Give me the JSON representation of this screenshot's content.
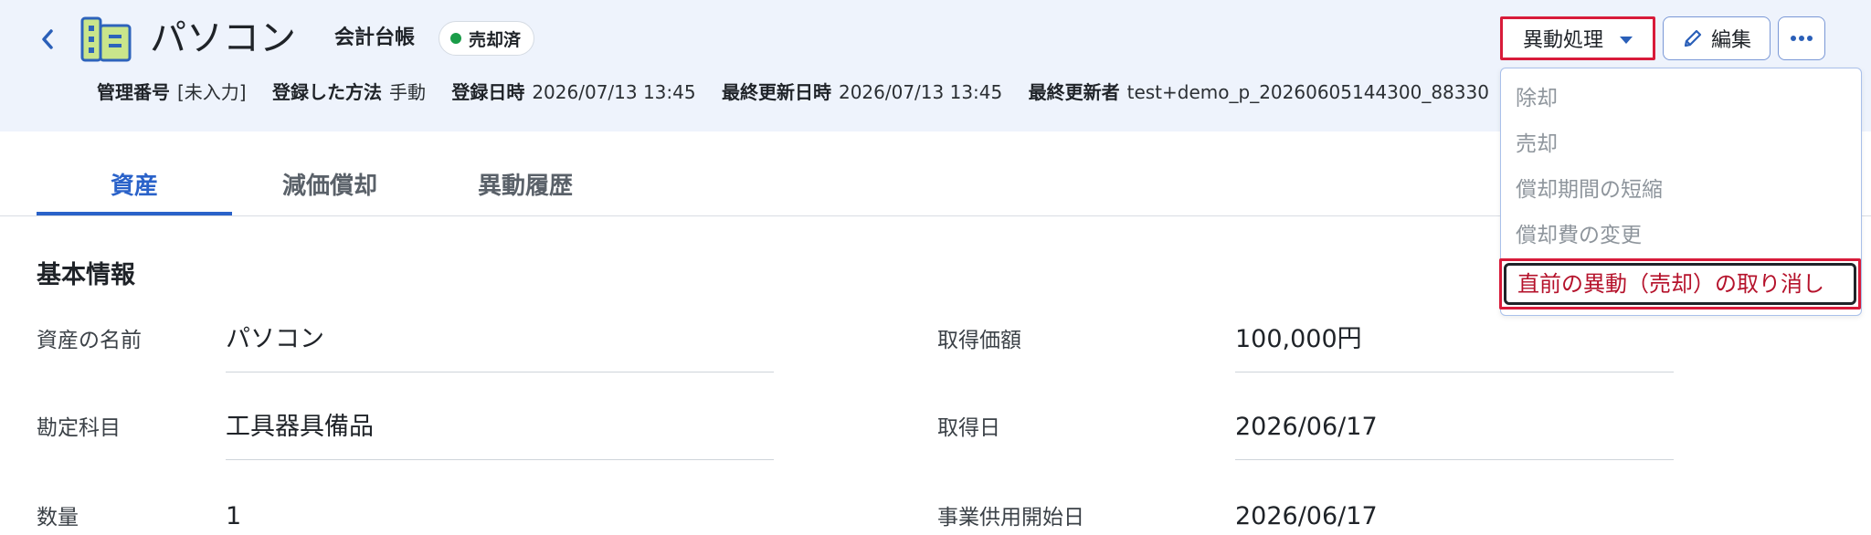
{
  "header": {
    "asset_name": "パソコン",
    "ledger_label": "会計台帳",
    "status": "売却済",
    "meta": [
      {
        "label": "管理番号",
        "value": "[未入力]"
      },
      {
        "label": "登録した方法",
        "value": "手動"
      },
      {
        "label": "登録日時",
        "value": "2026/07/13 13:45"
      },
      {
        "label": "最終更新日時",
        "value": "2026/07/13 13:45"
      },
      {
        "label": "最終更新者",
        "value": "test+demo_p_20260605144300_88330"
      }
    ]
  },
  "actions": {
    "ido_label": "異動処理",
    "edit_label": "編集",
    "menu": [
      "除却",
      "売却",
      "償却期間の短縮",
      "償却費の変更",
      "直前の異動（売却）の取り消し"
    ]
  },
  "tabs": [
    "資産",
    "減価償却",
    "異動履歴"
  ],
  "section": {
    "title": "基本情報",
    "fields_left": [
      {
        "label": "資産の名前",
        "value": "パソコン"
      },
      {
        "label": "勘定科目",
        "value": "工具器具備品"
      },
      {
        "label": "数量",
        "value": "1"
      }
    ],
    "fields_right": [
      {
        "label": "取得価額",
        "value": "100,000円"
      },
      {
        "label": "取得日",
        "value": "2026/06/17"
      },
      {
        "label": "事業供用開始日",
        "value": "2026/06/17"
      }
    ]
  },
  "colors": {
    "accent": "#2a62c9",
    "highlight_border": "#d81b3a",
    "status_dot": "#1a9c48",
    "header_bg": "#eef3fc"
  }
}
